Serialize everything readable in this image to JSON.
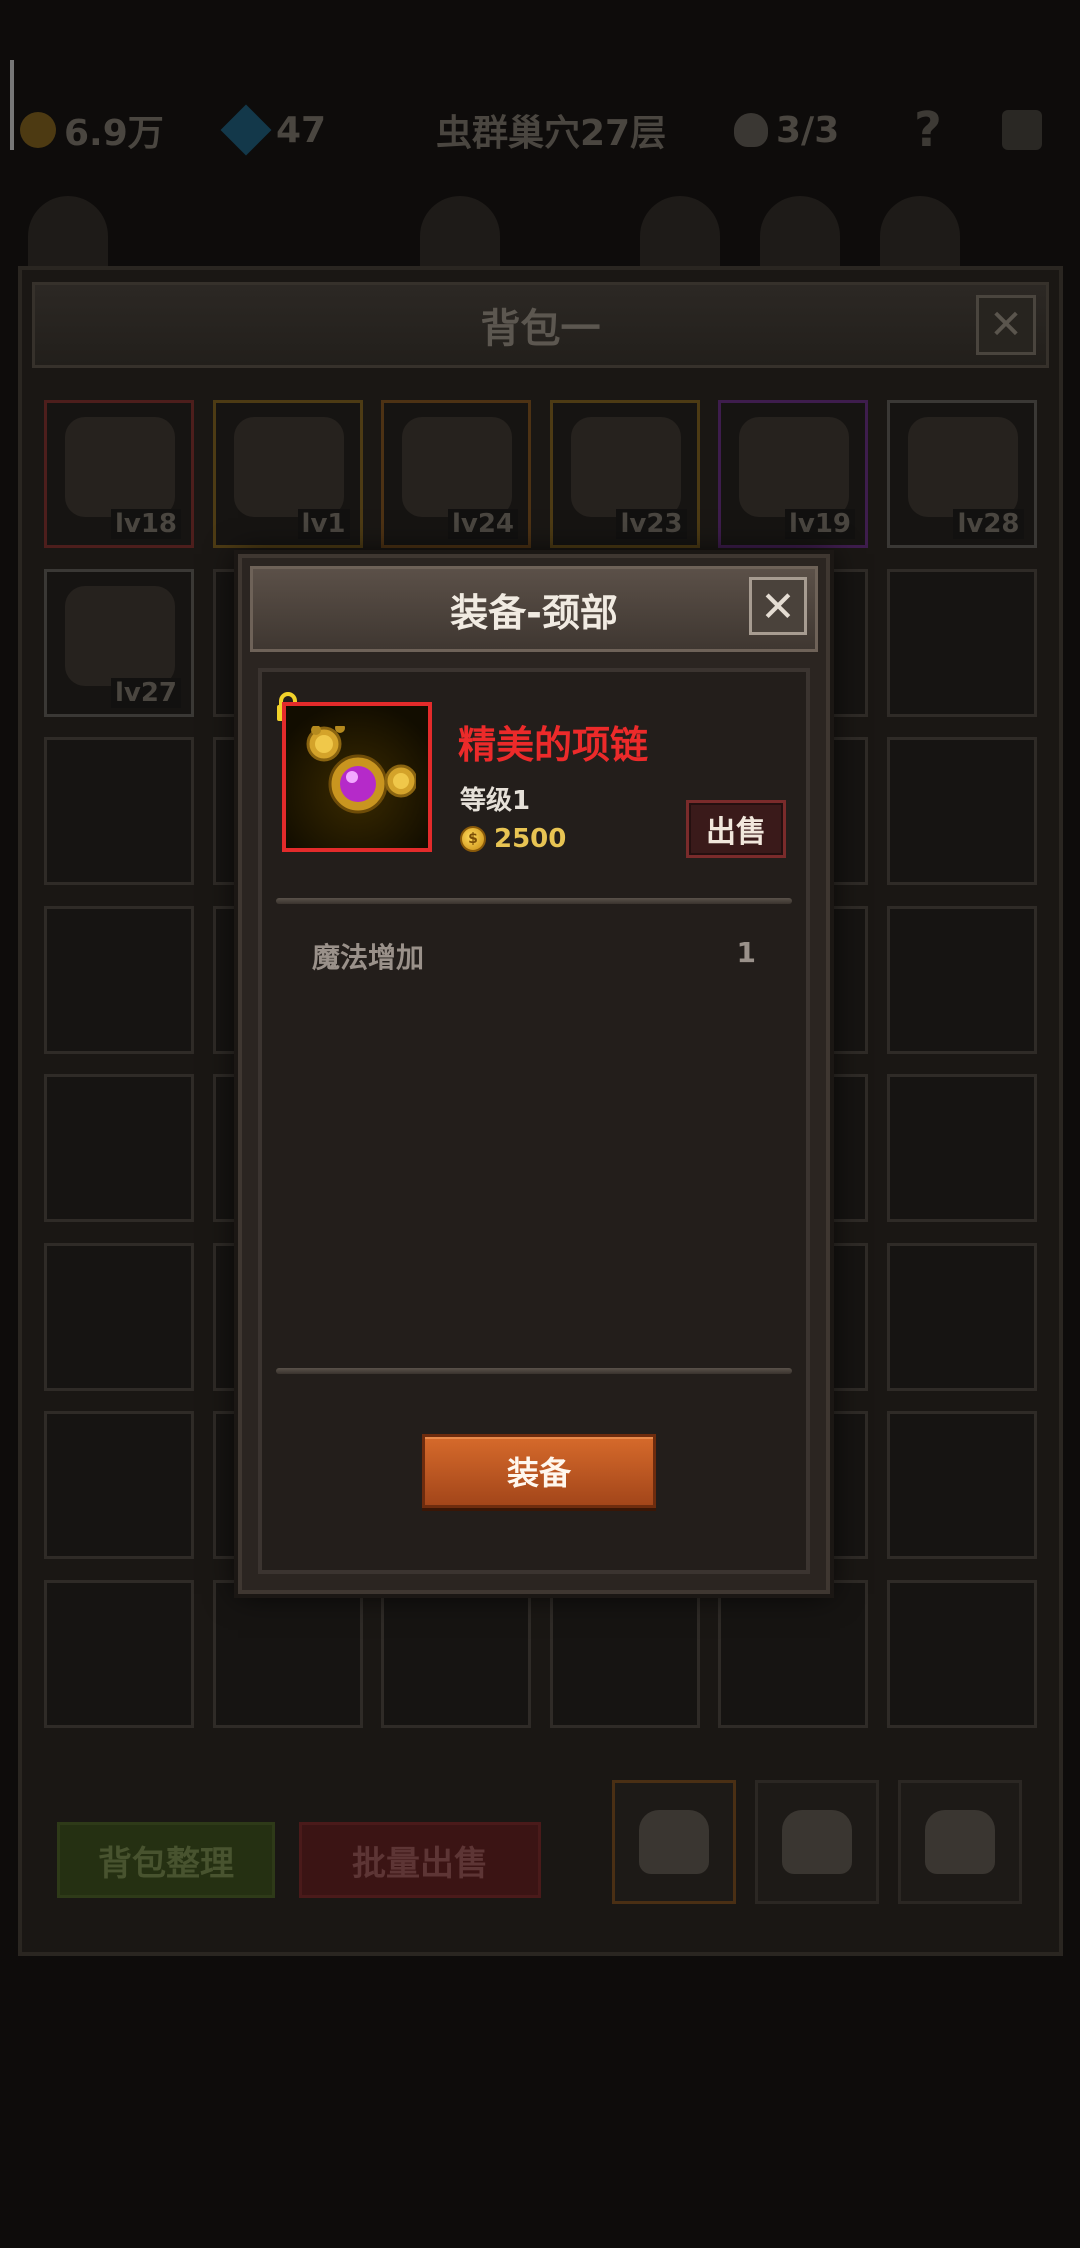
{
  "topbar": {
    "gold": "6.9万",
    "gems": "47",
    "location": "虫群巢穴27层",
    "skulls": "3/3",
    "help": "?"
  },
  "bag": {
    "title": "背包一",
    "close": "✕",
    "items": [
      {
        "level": "lv18",
        "rarity": "red",
        "icon": "scythe-icon"
      },
      {
        "level": "lv1",
        "rarity": "gold",
        "icon": "necklace-icon"
      },
      {
        "level": "lv24",
        "rarity": "orange",
        "icon": "pistol-icon"
      },
      {
        "level": "lv23",
        "rarity": "gold",
        "icon": "horn-icon"
      },
      {
        "level": "lv19",
        "rarity": "purple",
        "icon": "shield-icon"
      },
      {
        "level": "lv28",
        "rarity": "gray",
        "icon": "helmet-icon"
      },
      {
        "level": "lv27",
        "rarity": "gray",
        "icon": "club-icon"
      }
    ],
    "sort_button": "背包整理",
    "bulk_sell_button": "批量出售"
  },
  "modal": {
    "title": "装备-颈部",
    "close": "✕",
    "item": {
      "name": "精美的项链",
      "level": "等级1",
      "price": "2500",
      "coin_symbol": "$",
      "name_color": "#ec2a2a"
    },
    "sell_button": "出售",
    "attributes": [
      {
        "name": "魔法增加",
        "value": "1"
      }
    ],
    "equip_button": "装备"
  }
}
